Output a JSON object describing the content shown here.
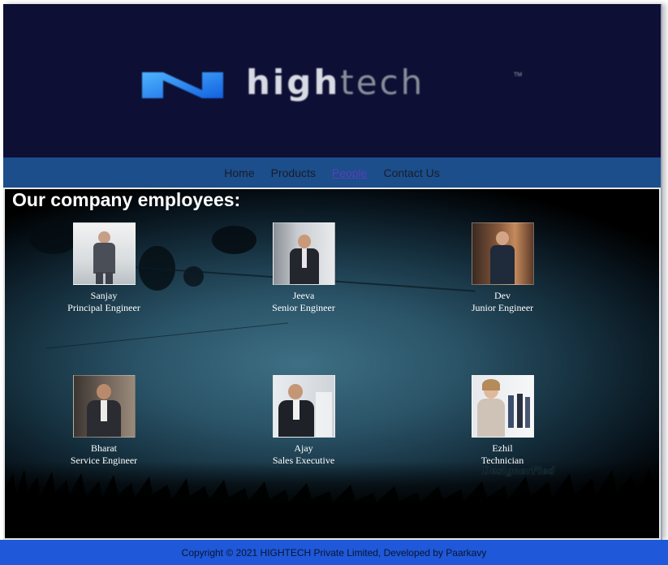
{
  "header": {
    "logo_text_bold": "high",
    "logo_text_light": "tech",
    "logo_tm": "TM"
  },
  "nav": {
    "items": [
      {
        "label": "Home"
      },
      {
        "label": "Products"
      },
      {
        "label": "People",
        "active": true
      },
      {
        "label": "Contact Us"
      }
    ]
  },
  "main": {
    "title": "Our company employees:",
    "employees": [
      {
        "name": "Sanjay",
        "role": "Principal Engineer"
      },
      {
        "name": "Jeeva",
        "role": "Senior Engineer"
      },
      {
        "name": "Dev",
        "role": "Junior Engineer"
      },
      {
        "name": "Bharat",
        "role": "Service Engineer"
      },
      {
        "name": "Ajay",
        "role": "Sales Executive"
      },
      {
        "name": "Ezhil",
        "role": "Technician"
      }
    ],
    "watermark": "DesignerFied"
  },
  "footer": {
    "text": "Copyright © 2021 HIGHTECH Private Limited, Developed by Paarkavy"
  },
  "colors": {
    "header_bg": "#0e0f35",
    "nav_bg": "#1b4e8a",
    "footer_bg": "#1f58d8",
    "logo_blue": "#1e88ff"
  }
}
